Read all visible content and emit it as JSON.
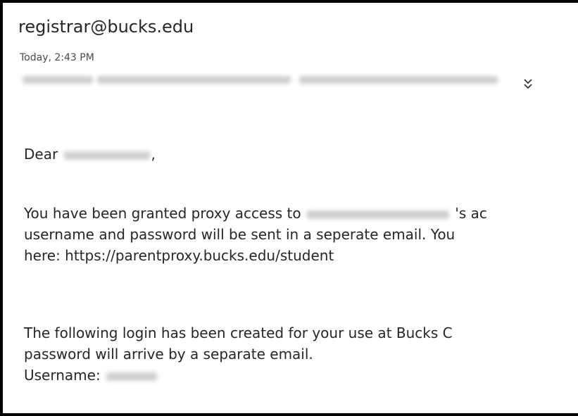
{
  "email": {
    "sender": "registrar@bucks.edu",
    "date": "Today, 2:43 PM",
    "expand_icon": "double-chevron-down-icon",
    "greeting_prefix": "Dear",
    "greeting_suffix": ",",
    "para1": {
      "line1_pre": "You have been granted proxy access to",
      "line1_post": "'s ac",
      "line2": "username and password will be sent in a seperate email. You",
      "line3": "here: https://parentproxy.bucks.edu/student"
    },
    "para2": {
      "line1": "The following login has been created for your use at Bucks C",
      "line2": "password will arrive by a separate email.",
      "line3_label": "Username:"
    }
  }
}
